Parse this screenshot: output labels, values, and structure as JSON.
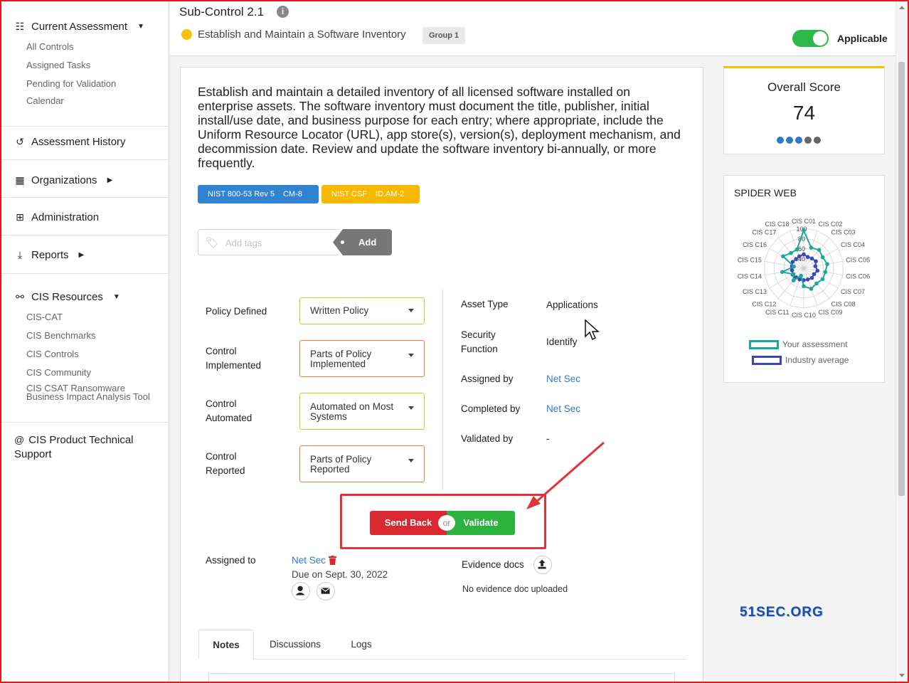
{
  "sidebar": {
    "current_assessment": {
      "label": "Current Assessment",
      "items": [
        "All Controls",
        "Assigned Tasks",
        "Pending for Validation",
        "Calendar"
      ]
    },
    "assessment_history": "Assessment History",
    "organizations": "Organizations",
    "administration": "Administration",
    "reports": "Reports",
    "cis_resources": {
      "label": "CIS Resources",
      "items": [
        "CIS-CAT",
        "CIS Benchmarks",
        "CIS Controls",
        "CIS Community"
      ],
      "ransomware_line1": "CIS CSAT Ransomware",
      "ransomware_line2": "Business Impact Analysis Tool"
    },
    "support_line1": "CIS Product Technical",
    "support_line2": "Support"
  },
  "header": {
    "title": "Sub-Control 2.1",
    "subtitle": "Establish and Maintain a Software Inventory",
    "group_badge": "Group 1",
    "applicable_label": "Applicable",
    "applicable_on": true
  },
  "control": {
    "description": "Establish and maintain a detailed inventory of all licensed software installed on enterprise assets. The software inventory must document the title, publisher, initial install/use date, and business purpose for each entry; where appropriate, include the Uniform Resource Locator (URL), app store(s), version(s), deployment mechanism, and decommission date. Review and update the software inventory bi-annually, or more frequently.",
    "refs": [
      {
        "framework": "NIST 800-53 Rev 5",
        "id": "CM-8",
        "color": "#2f83cf"
      },
      {
        "framework": "NIST CSF",
        "id": "ID.AM-2",
        "color": "#f6b900"
      }
    ],
    "tags_placeholder": "Add tags",
    "add_label": "Add"
  },
  "fields": {
    "policy_defined": {
      "line1": "Policy Defined",
      "value": "Written Policy"
    },
    "control_implemented": {
      "line1": "Control",
      "line2": "Implemented",
      "value_line1": "Parts of Policy",
      "value_line2": "Implemented"
    },
    "control_automated": {
      "line1": "Control",
      "line2": "Automated",
      "value_line1": "Automated on Most",
      "value_line2": "Systems"
    },
    "control_reported": {
      "line1": "Control",
      "line2": "Reported",
      "value_line1": "Parts of Policy",
      "value_line2": "Reported"
    }
  },
  "details": {
    "asset_type_label": "Asset Type",
    "asset_type": "Applications",
    "security_function_line1": "Security",
    "security_function_line2": "Function",
    "security_function": "Identify",
    "assigned_by_label": "Assigned by",
    "assigned_by": "Net Sec",
    "completed_by_label": "Completed by",
    "completed_by": "Net Sec",
    "validated_by_label": "Validated by",
    "validated_by": "-"
  },
  "actions": {
    "send_back": "Send Back",
    "or": "or",
    "validate": "Validate"
  },
  "assignment": {
    "label": "Assigned to",
    "assignee": "Net Sec",
    "due": "Due on Sept. 30, 2022",
    "evidence_label": "Evidence docs",
    "evidence_status": "No evidence doc uploaded"
  },
  "tabs": [
    "Notes",
    "Discussions",
    "Logs"
  ],
  "score": {
    "title": "Overall Score",
    "value": "74",
    "dot_colors": [
      "#2f7bc1",
      "#2f7bc1",
      "#2f7bc1",
      "#666666",
      "#666666"
    ]
  },
  "spider": {
    "title": "SPIDER WEB",
    "axis_labels": [
      "CIS C01",
      "CIS C02",
      "CIS C03",
      "CIS C04",
      "CIS C05",
      "CIS C06",
      "CIS C07",
      "CIS C08",
      "CIS C09",
      "CIS C10",
      "CIS C11",
      "CIS C12",
      "CIS C13",
      "CIS C14",
      "CIS C15",
      "CIS C16",
      "CIS C17",
      "CIS C18"
    ],
    "scale_labels": [
      "100",
      "80",
      "60",
      "40"
    ],
    "legend_yours": "Your assessment",
    "legend_industry": "Industry average",
    "color_yours": "#1aa89c",
    "color_industry": "#3a48b0"
  },
  "watermark": "51SEC.ORG"
}
